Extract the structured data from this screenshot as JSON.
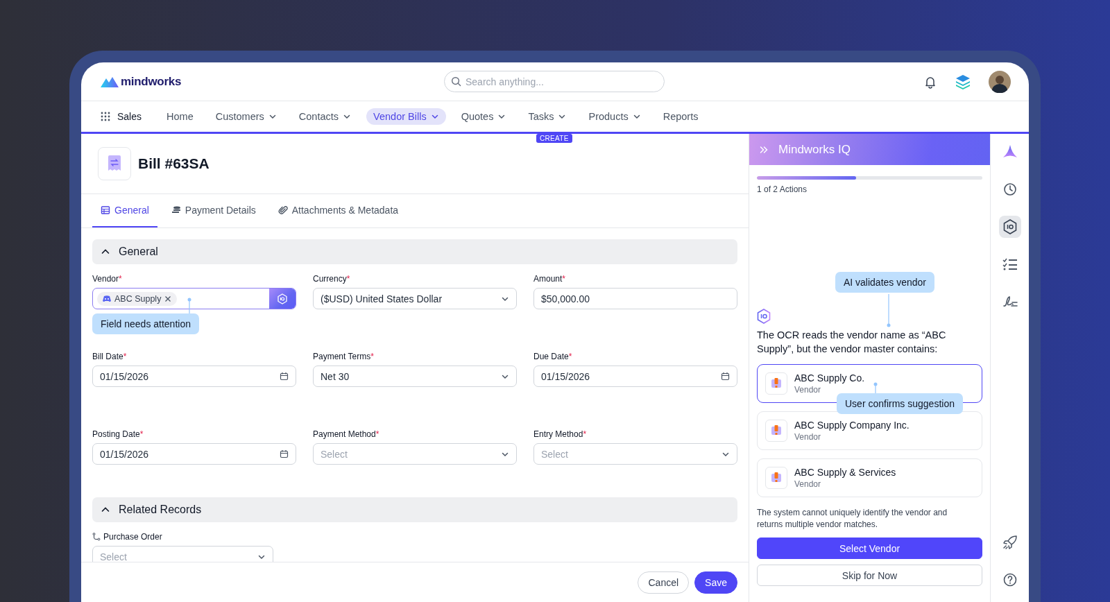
{
  "logo": {
    "text": "mindworks"
  },
  "search": {
    "placeholder": "Search anything..."
  },
  "nav": {
    "app": "Sales",
    "items": [
      {
        "label": "Home",
        "dropdown": false,
        "selected": false
      },
      {
        "label": "Customers",
        "dropdown": true,
        "selected": false
      },
      {
        "label": "Contacts",
        "dropdown": true,
        "selected": false
      },
      {
        "label": "Vendor Bills",
        "dropdown": true,
        "selected": true
      },
      {
        "label": "Quotes",
        "dropdown": true,
        "selected": false
      },
      {
        "label": "Tasks",
        "dropdown": true,
        "selected": false
      },
      {
        "label": "Products",
        "dropdown": true,
        "selected": false
      },
      {
        "label": "Reports",
        "dropdown": false,
        "selected": false
      }
    ]
  },
  "mode_badge": "CREATE",
  "required_mark": "*",
  "record": {
    "title": "Bill #63SA"
  },
  "tabs": [
    {
      "label": "General",
      "selected": true
    },
    {
      "label": "Payment Details",
      "selected": false
    },
    {
      "label": "Attachments & Metadata",
      "selected": false
    }
  ],
  "sections": [
    {
      "title": "General",
      "expanded": true,
      "fields": [
        {
          "label": "Vendor",
          "required": true,
          "kind": "tag",
          "tag": "ABC Supply",
          "hint": "Field needs attention"
        },
        {
          "label": "Currency",
          "required": true,
          "kind": "select",
          "value": "($USD) United States Dollar"
        },
        {
          "label": "Amount",
          "required": true,
          "kind": "text",
          "value": "$50,000.00"
        },
        {
          "label": "Bill Date",
          "required": true,
          "kind": "date",
          "value": "01/15/2026"
        },
        {
          "label": "Payment Terms",
          "required": true,
          "kind": "select",
          "value": "Net 30"
        },
        {
          "label": "Due Date",
          "required": true,
          "kind": "date",
          "value": "01/15/2026"
        },
        {
          "label": "Posting Date",
          "required": true,
          "kind": "date",
          "value": "01/15/2026"
        },
        {
          "label": "Payment Method",
          "required": true,
          "kind": "select",
          "placeholder": "Select"
        },
        {
          "label": "Entry Method",
          "required": true,
          "kind": "select",
          "placeholder": "Select"
        }
      ]
    },
    {
      "title": "Related Records",
      "expanded": true,
      "fields": [
        {
          "label": "Purchase Order",
          "required": false,
          "kind": "select",
          "placeholder": "Select",
          "linked": true
        }
      ]
    }
  ],
  "footer": {
    "buttons": [
      {
        "label": "Cancel",
        "kind": "secondary"
      },
      {
        "label": "Save",
        "kind": "primary"
      }
    ]
  },
  "assistant": {
    "title": "Mindworks IQ",
    "progress": {
      "level": 0.44,
      "label": "1 of 2 Actions"
    },
    "annotation": "AI validates vendor",
    "message": "The OCR reads the vendor name as “ABC Supply”, but the vendor master contains:",
    "matches": [
      {
        "name": "ABC Supply Co.",
        "type": "Vendor",
        "selected": true,
        "annotation": "User confirms suggestion"
      },
      {
        "name": "ABC Supply Company Inc.",
        "type": "Vendor",
        "selected": false
      },
      {
        "name": "ABC Supply & Services",
        "type": "Vendor",
        "selected": false
      }
    ],
    "note": "The system cannot uniquely identify the vendor and returns multiple vendor matches.",
    "buttons": [
      {
        "label": "Select Vendor",
        "kind": "primary"
      },
      {
        "label": "Skip for Now",
        "kind": "secondary"
      }
    ]
  },
  "rail": [
    {
      "selected": false
    },
    {
      "selected": false
    },
    {
      "selected": true
    },
    {
      "selected": false
    },
    {
      "selected": false
    },
    {
      "selected": false
    },
    {
      "selected": false
    }
  ]
}
